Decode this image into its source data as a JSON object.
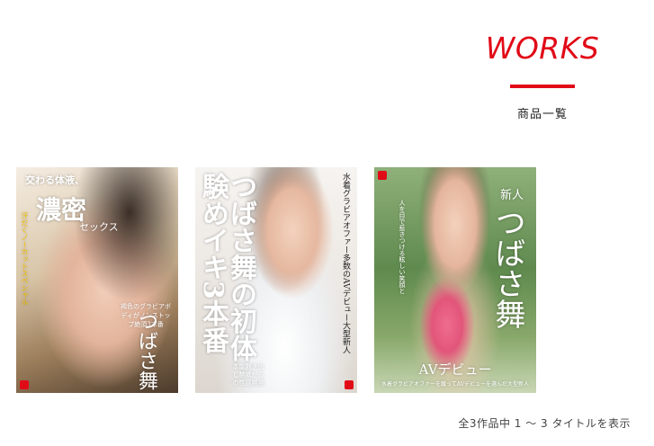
{
  "header": {
    "title": "WORKS",
    "subtitle": "商品一覧"
  },
  "products": [
    {
      "cover_texts": {
        "top": "交わる体液、",
        "big": "濃密",
        "big2": "セックス",
        "side": "汗だくノーカットスペシャル",
        "block": "褐色のグラビアボディがノンストップ絶頂3本番",
        "name": "つばさ舞"
      }
    },
    {
      "cover_texts": {
        "title": "つばさ舞の初体験めイキ3本番",
        "side": "水着グラビアオファー多数のAVデビュー大型新人",
        "block": "本能剥き出し禁欲からの性感開発"
      }
    },
    {
      "cover_texts": {
        "new": "新人",
        "name": "つばさ舞",
        "side": "人を目で惹きつける眩しい笑顔と",
        "av": "AVデビュー",
        "sub": "水着グラビアオファーを蹴ってAVデビューを選んだ大型新人"
      }
    }
  ],
  "footer": {
    "result_text": "全3作品中 1 〜 3 タイトルを表示"
  },
  "colors": {
    "accent": "#e10a17",
    "text": "#222222",
    "background": "#ffffff"
  }
}
